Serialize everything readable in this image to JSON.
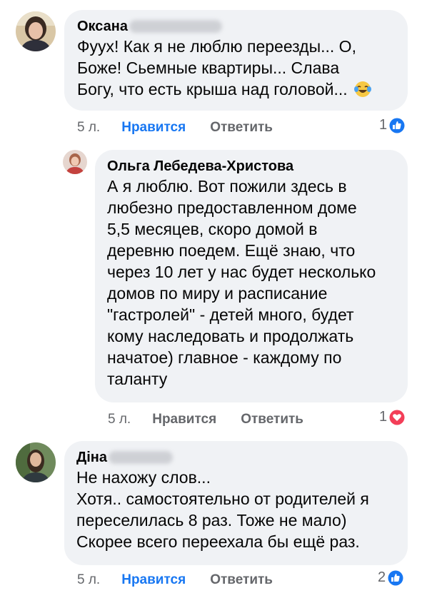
{
  "comments": [
    {
      "author": "Оксана",
      "lines": [
        "Фуух!  Как я не люблю переезды... О,",
        "Боже!  Сьемные квартиры... Слава",
        "Богу, что есть крыша над головой..."
      ],
      "emoji": "laughing-tears-emoji",
      "time": "5 л.",
      "like_label": "Нравится",
      "reply_label": "Ответить",
      "reaction_count": "1",
      "reaction_type": "like-reaction-icon",
      "liked": true
    },
    {
      "author": "Ольга Лебедева-Христова",
      "lines": [
        "А я люблю. Вот пожили здесь в",
        "любезно предоставленном доме",
        "5,5 месяцев, скоро домой в",
        "деревню поедем. Ещё знаю, что",
        "через 10 лет у нас будет несколько",
        "домов по миру и расписание",
        "\"гастролей\" - детей много, будет",
        "кому наследовать и продолжать",
        "начатое) главное - каждому по",
        "таланту"
      ],
      "time": "5 л.",
      "like_label": "Нравится",
      "reply_label": "Ответить",
      "reaction_count": "1",
      "reaction_type": "love-reaction-icon",
      "liked": false
    },
    {
      "author": "Діна",
      "lines": [
        "Не нахожу слов...",
        "Хотя.. самостоятельно от родителей я",
        "переселилась 8 раз. Тоже не мало)",
        "Скорее всего переехала бы ещё раз."
      ],
      "time": "5 л.",
      "like_label": "Нравится",
      "reply_label": "Ответить",
      "reaction_count": "2",
      "reaction_type": "like-reaction-icon",
      "liked": true
    }
  ],
  "colors": {
    "bubble": "#f0f2f5",
    "like_active": "#1877f2",
    "secondary_text": "#65676b",
    "love": "#f33e58"
  }
}
